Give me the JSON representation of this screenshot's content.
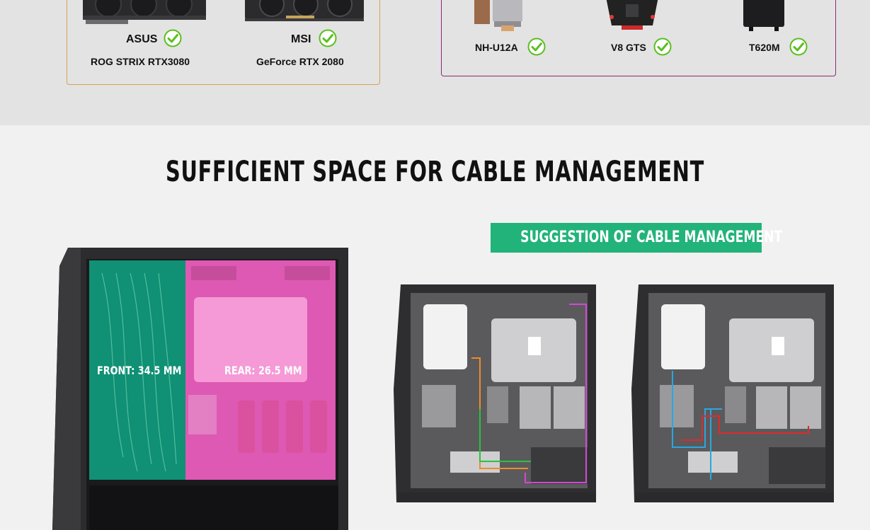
{
  "gpu_compat": {
    "items": [
      {
        "brand": "ASUS",
        "model": "ROG STRIX RTX3080",
        "compatible": true
      },
      {
        "brand": "MSI",
        "model": "GeForce RTX 2080",
        "compatible": true
      }
    ],
    "border_color": "#d4a24f"
  },
  "cooler_compat": {
    "items": [
      {
        "model": "NH-U12A",
        "compatible": true
      },
      {
        "model": "V8 GTS",
        "compatible": true
      },
      {
        "model": "T620M",
        "compatible": true
      }
    ],
    "border_color": "#8a2a74"
  },
  "cable_section": {
    "title": "SUFFICIENT SPACE FOR CABLE MANAGEMENT",
    "suggestion_label": "SUGGESTION OF CABLE MANAGEMENT",
    "front_clearance": "FRONT: 34.5 MM",
    "rear_clearance": "REAR: 26.5 MM",
    "accent_green": "#22b37a",
    "front_zone_color": "#0f9a7c",
    "rear_zone_color": "#ef5ec0",
    "check_color": "#5cbf1e"
  }
}
